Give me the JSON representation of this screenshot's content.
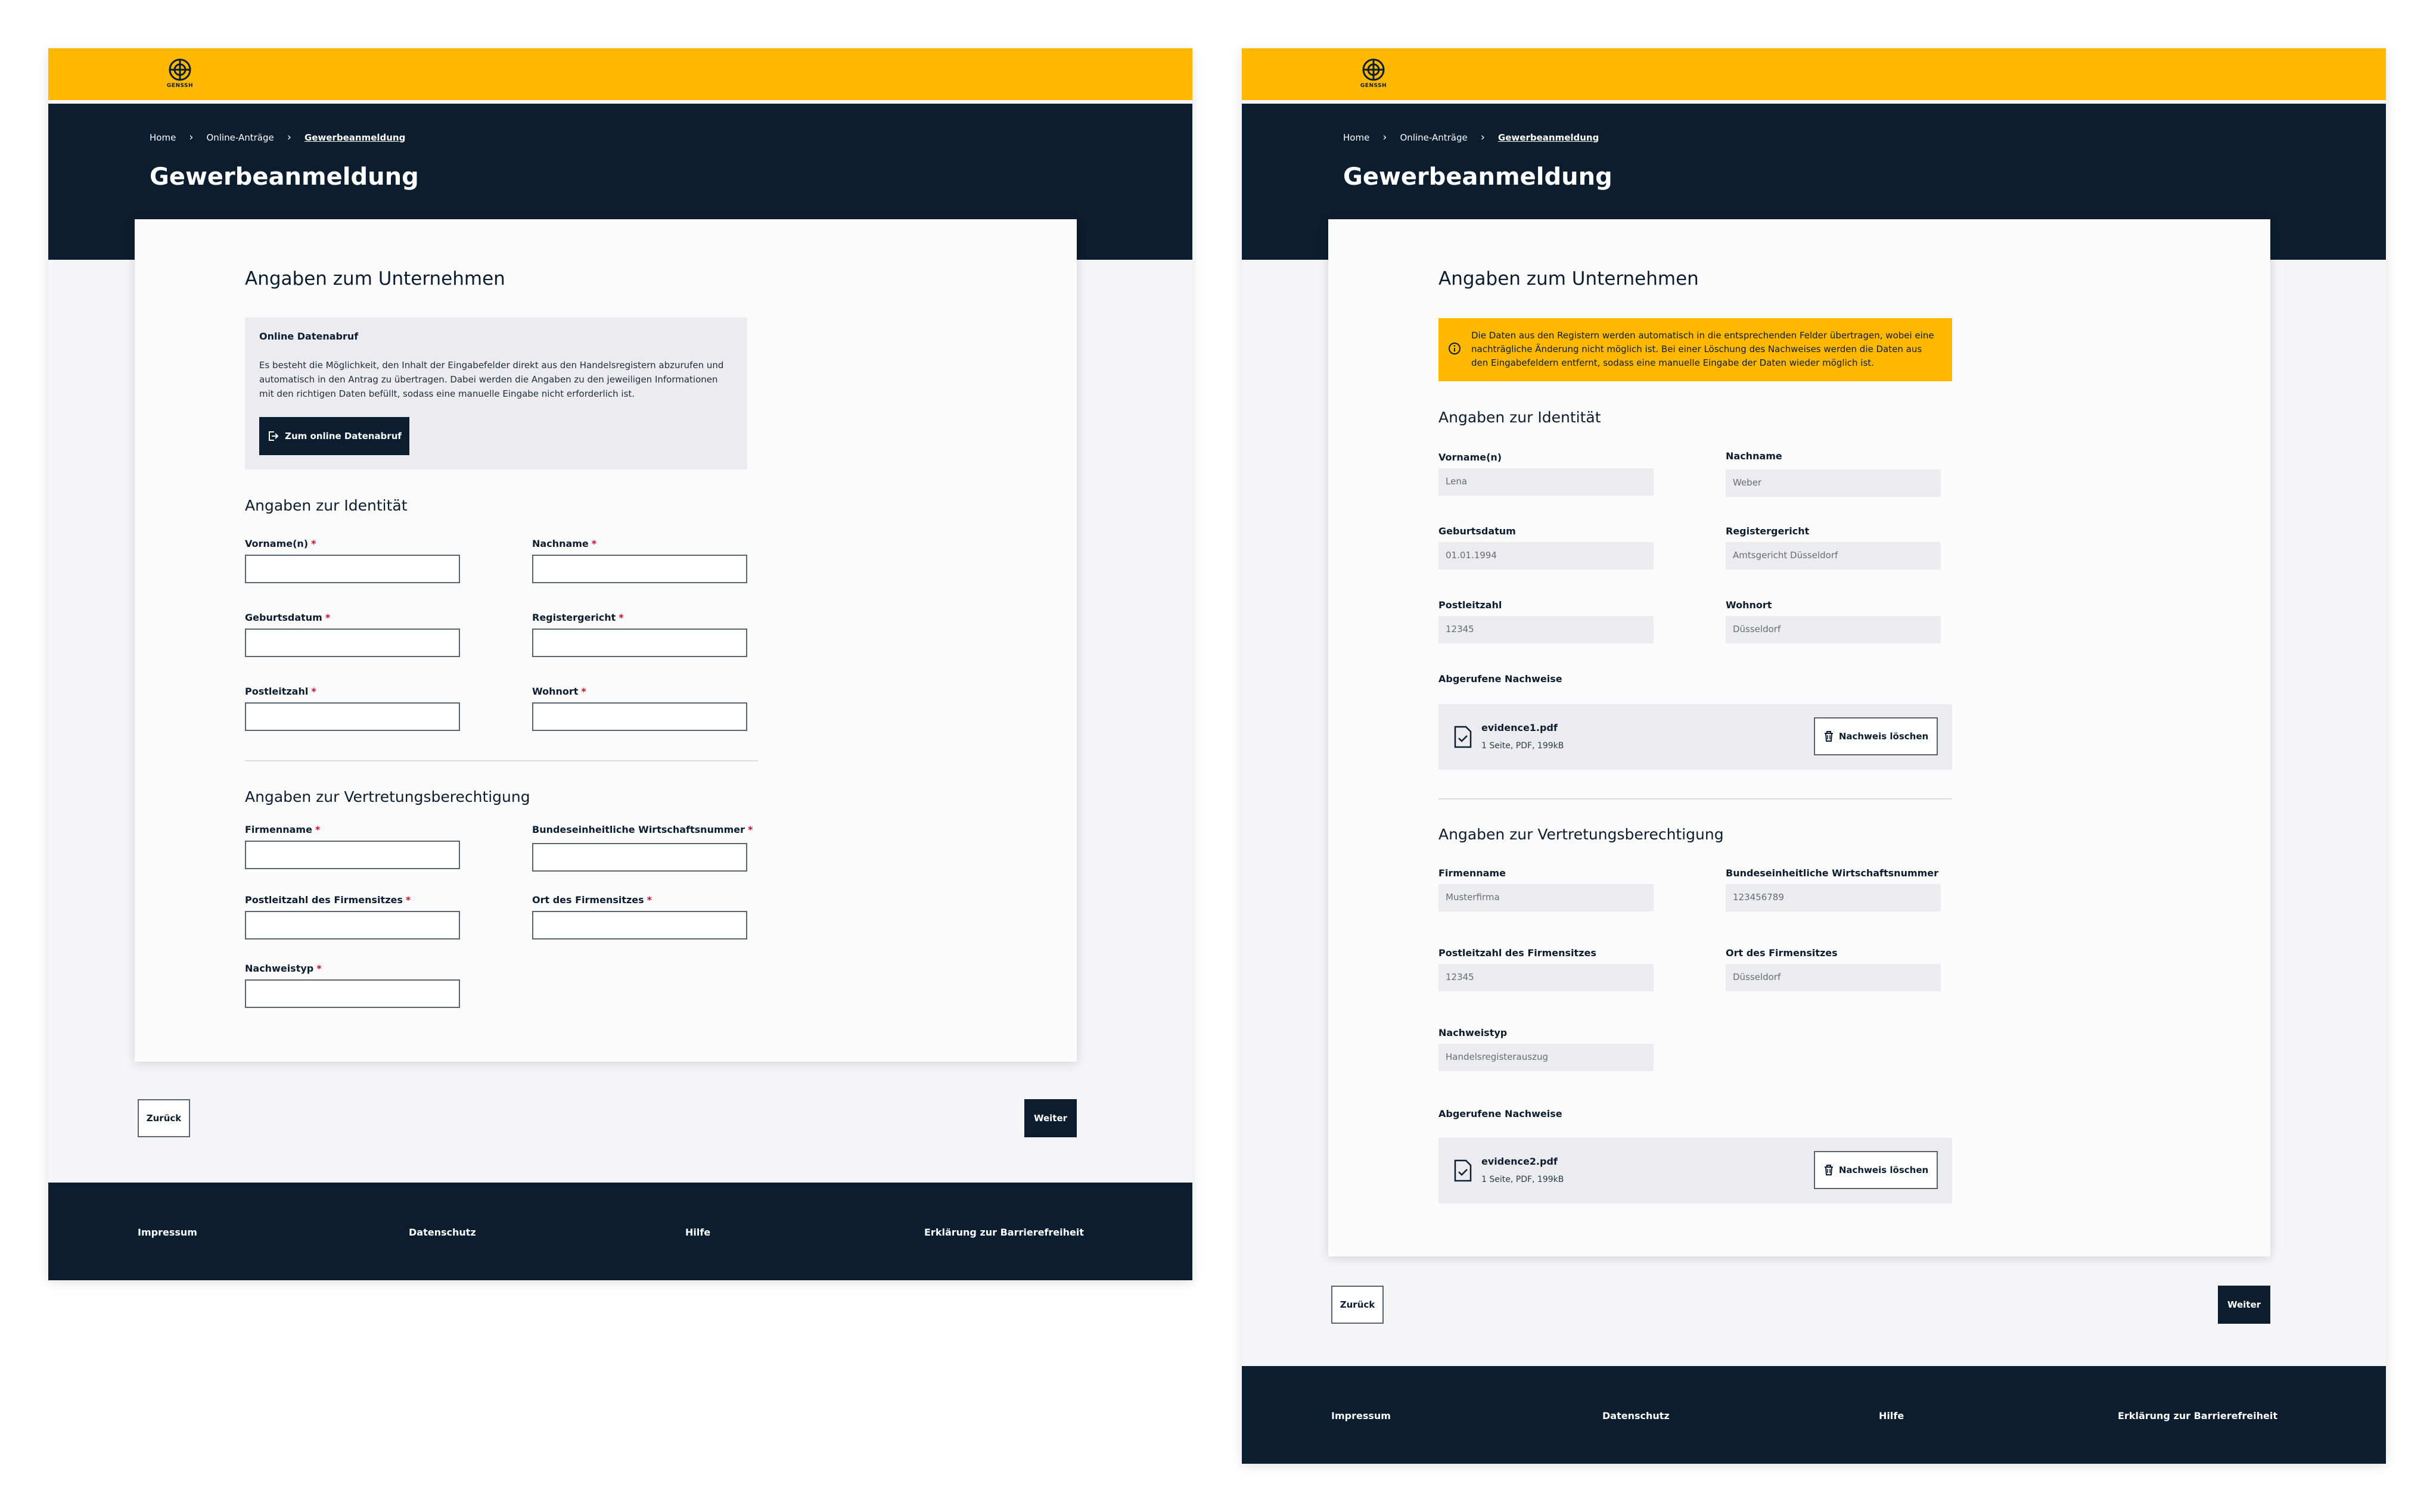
{
  "app": {
    "logo_text": "GENSSH",
    "breadcrumb": [
      "Home",
      "Online-Anträge",
      "Gewerbeanmeldung"
    ],
    "title": "Gewerbeanmeldung"
  },
  "colors": {
    "brand_yellow": "#ffb800",
    "navy": "#0b1d2e",
    "required": "#c8102e"
  },
  "screenA": {
    "section_title": "Angaben zum Unternehmen",
    "online_box": {
      "title": "Online Datenabruf",
      "text_lines": [
        "Es besteht die Möglichkeit, den Inhalt der Eingabefelder direkt aus den Handelsregistern abzurufen und",
        "automatisch in den Antrag zu übertragen. Dabei werden die Angaben zu den jeweiligen Informationen",
        "mit den richtigen Daten befüllt, sodass eine manuelle Eingabe nicht erforderlich ist."
      ],
      "button": "Zum online Datenabruf"
    },
    "identity": {
      "title": "Angaben zur Identität",
      "fields": [
        "Vorname(n)",
        "Nachname",
        "Geburtsdatum",
        "Registergericht",
        "Postleitzahl",
        "Wohnort"
      ]
    },
    "representation": {
      "title": "Angaben zur Vertretungsberechtigung",
      "fields": [
        "Firmenname",
        "Bundeseinheitliche Wirtschaftsnummer",
        "Postleitzahl des Firmensitzes",
        "Ort des Firmensitzes",
        "Nachweistyp"
      ]
    },
    "back_button": "Zurück",
    "next_button": "Weiter"
  },
  "screenB": {
    "section_title": "Angaben zum Unternehmen",
    "warning_lines": [
      "Die Daten aus den Registern werden automatisch in die entsprechenden Felder übertragen, wobei eine",
      "nachträgliche Änderung nicht möglich ist. Bei einer Löschung des Nachweises werden die Daten aus",
      "den Eingabefeldern entfernt, sodass eine manuelle Eingabe der Daten wieder möglich ist."
    ],
    "identity": {
      "title": "Angaben zur Identität",
      "fields": [
        {
          "label": "Vorname(n)",
          "value": "Lena"
        },
        {
          "label": "Nachname",
          "value": "Weber"
        },
        {
          "label": "Geburtsdatum",
          "value": "01.01.1994"
        },
        {
          "label": "Registergericht",
          "value": "Amtsgericht Düsseldorf"
        },
        {
          "label": "Postleitzahl",
          "value": "12345"
        },
        {
          "label": "Wohnort",
          "value": "Düsseldorf"
        }
      ],
      "evidence_label": "Abgerufene Nachweise",
      "evidence": {
        "name": "evidence1.pdf",
        "meta": "1 Seite, PDF, 199kB",
        "delete": "Nachweis löschen"
      }
    },
    "representation": {
      "title": "Angaben zur Vertretungsberechtigung",
      "fields": [
        {
          "label": "Firmenname",
          "value": "Musterfirma"
        },
        {
          "label": "Bundeseinheitliche Wirtschaftsnummer",
          "value": "123456789"
        },
        {
          "label": "Postleitzahl des Firmensitzes",
          "value": "12345"
        },
        {
          "label": "Ort des Firmensitzes",
          "value": "Düsseldorf"
        },
        {
          "label": "Nachweistyp",
          "value": "Handelsregisterauszug"
        }
      ],
      "evidence_label": "Abgerufene Nachweise",
      "evidence": {
        "name": "evidence2.pdf",
        "meta": "1 Seite, PDF, 199kB",
        "delete": "Nachweis löschen"
      }
    },
    "back_button": "Zurück",
    "next_button": "Weiter"
  },
  "footer": {
    "links": [
      "Impressum",
      "Datenschutz",
      "Hilfe",
      "Erklärung zur Barrierefreiheit"
    ]
  }
}
